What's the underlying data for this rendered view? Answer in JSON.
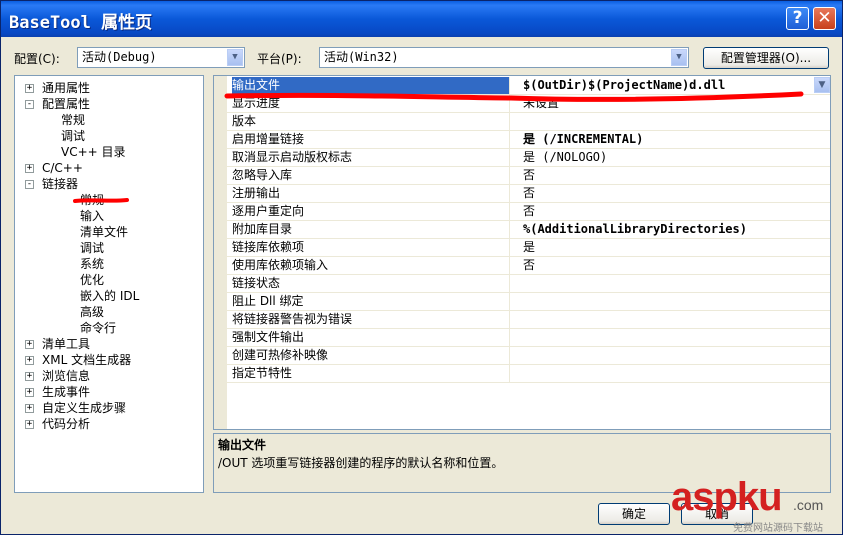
{
  "window": {
    "title": "BaseTool 属性页",
    "help": "?",
    "close": "✕"
  },
  "toolbar": {
    "config_label": "配置(C):",
    "config_value": "活动(Debug)",
    "platform_label": "平台(P):",
    "platform_value": "活动(Win32)",
    "config_manager": "配置管理器(O)..."
  },
  "tree": {
    "nodes": [
      {
        "label": "通用属性",
        "pm": "+"
      },
      {
        "label": "配置属性",
        "pm": "-"
      },
      {
        "label": "常规"
      },
      {
        "label": "调试"
      },
      {
        "label": "VC++ 目录"
      },
      {
        "label": "C/C++",
        "pm": "+"
      },
      {
        "label": "链接器",
        "pm": "-"
      },
      {
        "label": "常规"
      },
      {
        "label": "输入"
      },
      {
        "label": "清单文件"
      },
      {
        "label": "调试"
      },
      {
        "label": "系统"
      },
      {
        "label": "优化"
      },
      {
        "label": "嵌入的 IDL"
      },
      {
        "label": "高级"
      },
      {
        "label": "命令行"
      },
      {
        "label": "清单工具",
        "pm": "+"
      },
      {
        "label": "XML 文档生成器",
        "pm": "+"
      },
      {
        "label": "浏览信息",
        "pm": "+"
      },
      {
        "label": "生成事件",
        "pm": "+"
      },
      {
        "label": "自定义生成步骤",
        "pm": "+"
      },
      {
        "label": "代码分析",
        "pm": "+"
      }
    ]
  },
  "properties": [
    {
      "name": "输出文件",
      "value": "$(OutDir)$(ProjectName)d.dll",
      "bold": true
    },
    {
      "name": "显示进度",
      "value": "未设置"
    },
    {
      "name": "版本",
      "value": ""
    },
    {
      "name": "启用增量链接",
      "value": "是 (/INCREMENTAL)",
      "bold": true
    },
    {
      "name": "取消显示启动版权标志",
      "value": "是 (/NOLOGO)"
    },
    {
      "name": "忽略导入库",
      "value": "否"
    },
    {
      "name": "注册输出",
      "value": "否"
    },
    {
      "name": "逐用户重定向",
      "value": "否"
    },
    {
      "name": "附加库目录",
      "value": "%(AdditionalLibraryDirectories)",
      "bold": true
    },
    {
      "name": "链接库依赖项",
      "value": "是"
    },
    {
      "name": "使用库依赖项输入",
      "value": "否"
    },
    {
      "name": "链接状态",
      "value": ""
    },
    {
      "name": "阻止 Dll 绑定",
      "value": ""
    },
    {
      "name": "将链接器警告视为错误",
      "value": ""
    },
    {
      "name": "强制文件输出",
      "value": ""
    },
    {
      "name": "创建可热修补映像",
      "value": ""
    },
    {
      "name": "指定节特性",
      "value": ""
    }
  ],
  "description": {
    "title": "输出文件",
    "text": "/OUT 选项重写链接器创建的程序的默认名称和位置。"
  },
  "buttons": {
    "ok": "确定",
    "cancel": "取消"
  },
  "watermark": {
    "brand": "aspku",
    "suffix": ".com",
    "sub": "免费网站源码下载站"
  },
  "colors": {
    "selection": "#316ac5",
    "annotation": "#ff0000",
    "titlebar": "#0a58d8"
  }
}
